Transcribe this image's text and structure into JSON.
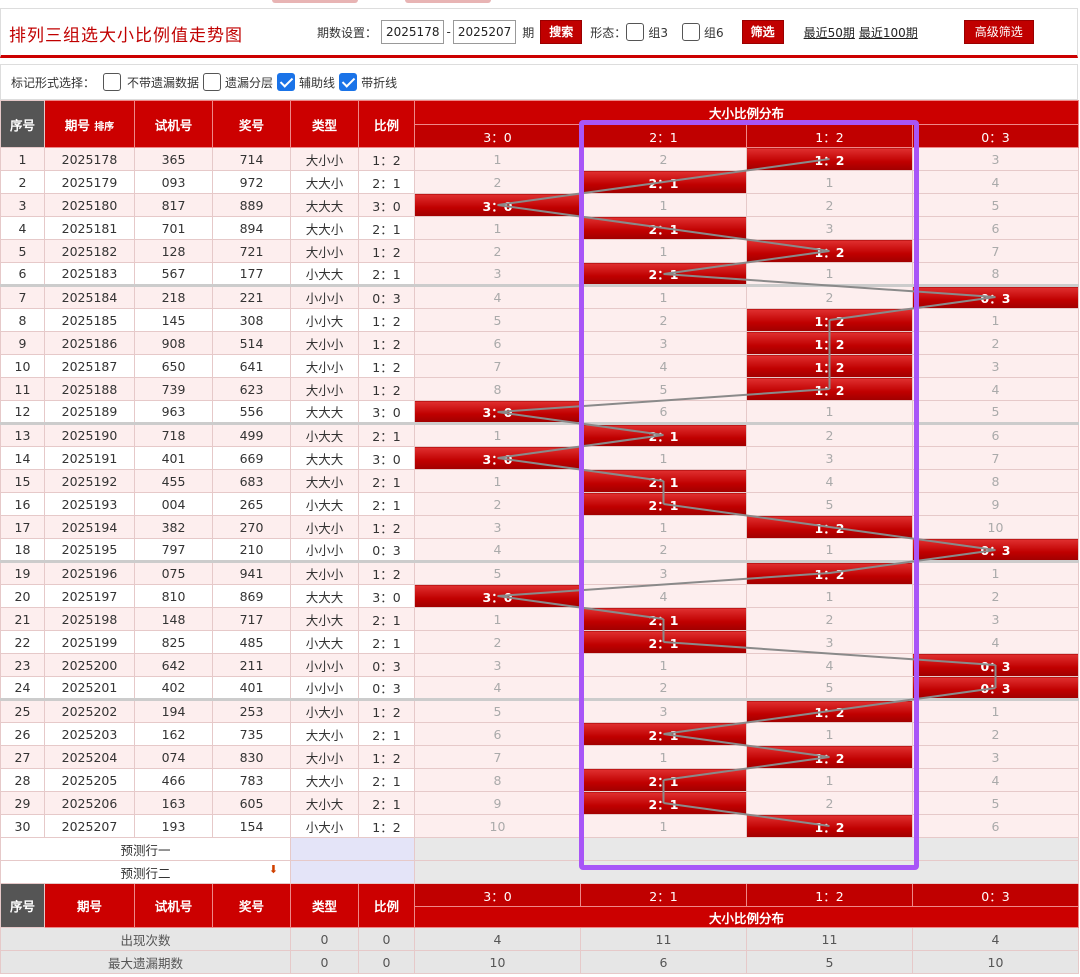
{
  "header": {
    "title": "排列三组选大小比例值走势图",
    "period_label": "期数设置：",
    "period_start": "2025178",
    "period_sep": "-",
    "period_end": "2025207",
    "period_unit": "期",
    "search_btn": "搜索",
    "shape_label": "形态：",
    "group3_label": "组3",
    "group6_label": "组6",
    "filter_btn": "筛选",
    "recent50": "最近50期",
    "recent100": "最近100期",
    "advanced_btn": "高级筛选"
  },
  "mark_bar": {
    "label": "标记形式选择：",
    "opt1": "不带遗漏数据",
    "opt2": "遗漏分层",
    "opt3": "辅助线",
    "opt4": "带折线"
  },
  "table_head": {
    "seq": "序号",
    "issue": "期号",
    "sort": "排序",
    "test": "试机号",
    "prize": "奖号",
    "type": "类型",
    "ratio": "比例",
    "dist": "大小比例分布",
    "cols": [
      "3：0",
      "2：1",
      "1：2",
      "0：3"
    ]
  },
  "rows": [
    {
      "seq": "1",
      "issue": "2025178",
      "test": "365",
      "prize": "714",
      "type": "大小小",
      "ratio": "1：2",
      "d": [
        "1",
        "2",
        "1：2",
        "3"
      ],
      "hit": 2
    },
    {
      "seq": "2",
      "issue": "2025179",
      "test": "093",
      "prize": "972",
      "type": "大大小",
      "ratio": "2：1",
      "d": [
        "2",
        "2：1",
        "1",
        "4"
      ],
      "hit": 1
    },
    {
      "seq": "3",
      "issue": "2025180",
      "test": "817",
      "prize": "889",
      "type": "大大大",
      "ratio": "3：0",
      "d": [
        "3：0",
        "1",
        "2",
        "5"
      ],
      "hit": 0
    },
    {
      "seq": "4",
      "issue": "2025181",
      "test": "701",
      "prize": "894",
      "type": "大大小",
      "ratio": "2：1",
      "d": [
        "1",
        "2：1",
        "3",
        "6"
      ],
      "hit": 1
    },
    {
      "seq": "5",
      "issue": "2025182",
      "test": "128",
      "prize": "721",
      "type": "大小小",
      "ratio": "1：2",
      "d": [
        "2",
        "1",
        "1：2",
        "7"
      ],
      "hit": 2
    },
    {
      "seq": "6",
      "issue": "2025183",
      "test": "567",
      "prize": "177",
      "type": "小大大",
      "ratio": "2：1",
      "d": [
        "3",
        "2：1",
        "1",
        "8"
      ],
      "hit": 1
    },
    {
      "seq": "7",
      "issue": "2025184",
      "test": "218",
      "prize": "221",
      "type": "小小小",
      "ratio": "0：3",
      "d": [
        "4",
        "1",
        "2",
        "0：3"
      ],
      "hit": 3
    },
    {
      "seq": "8",
      "issue": "2025185",
      "test": "145",
      "prize": "308",
      "type": "小小大",
      "ratio": "1：2",
      "d": [
        "5",
        "2",
        "1：2",
        "1"
      ],
      "hit": 2
    },
    {
      "seq": "9",
      "issue": "2025186",
      "test": "908",
      "prize": "514",
      "type": "大小小",
      "ratio": "1：2",
      "d": [
        "6",
        "3",
        "1：2",
        "2"
      ],
      "hit": 2
    },
    {
      "seq": "10",
      "issue": "2025187",
      "test": "650",
      "prize": "641",
      "type": "大小小",
      "ratio": "1：2",
      "d": [
        "7",
        "4",
        "1：2",
        "3"
      ],
      "hit": 2
    },
    {
      "seq": "11",
      "issue": "2025188",
      "test": "739",
      "prize": "623",
      "type": "大小小",
      "ratio": "1：2",
      "d": [
        "8",
        "5",
        "1：2",
        "4"
      ],
      "hit": 2
    },
    {
      "seq": "12",
      "issue": "2025189",
      "test": "963",
      "prize": "556",
      "type": "大大大",
      "ratio": "3：0",
      "d": [
        "3：0",
        "6",
        "1",
        "5"
      ],
      "hit": 0
    },
    {
      "seq": "13",
      "issue": "2025190",
      "test": "718",
      "prize": "499",
      "type": "小大大",
      "ratio": "2：1",
      "d": [
        "1",
        "2：1",
        "2",
        "6"
      ],
      "hit": 1
    },
    {
      "seq": "14",
      "issue": "2025191",
      "test": "401",
      "prize": "669",
      "type": "大大大",
      "ratio": "3：0",
      "d": [
        "3：0",
        "1",
        "3",
        "7"
      ],
      "hit": 0
    },
    {
      "seq": "15",
      "issue": "2025192",
      "test": "455",
      "prize": "683",
      "type": "大大小",
      "ratio": "2：1",
      "d": [
        "1",
        "2：1",
        "4",
        "8"
      ],
      "hit": 1
    },
    {
      "seq": "16",
      "issue": "2025193",
      "test": "004",
      "prize": "265",
      "type": "小大大",
      "ratio": "2：1",
      "d": [
        "2",
        "2：1",
        "5",
        "9"
      ],
      "hit": 1
    },
    {
      "seq": "17",
      "issue": "2025194",
      "test": "382",
      "prize": "270",
      "type": "小大小",
      "ratio": "1：2",
      "d": [
        "3",
        "1",
        "1：2",
        "10"
      ],
      "hit": 2
    },
    {
      "seq": "18",
      "issue": "2025195",
      "test": "797",
      "prize": "210",
      "type": "小小小",
      "ratio": "0：3",
      "d": [
        "4",
        "2",
        "1",
        "0：3"
      ],
      "hit": 3
    },
    {
      "seq": "19",
      "issue": "2025196",
      "test": "075",
      "prize": "941",
      "type": "大小小",
      "ratio": "1：2",
      "d": [
        "5",
        "3",
        "1：2",
        "1"
      ],
      "hit": 2
    },
    {
      "seq": "20",
      "issue": "2025197",
      "test": "810",
      "prize": "869",
      "type": "大大大",
      "ratio": "3：0",
      "d": [
        "3：0",
        "4",
        "1",
        "2"
      ],
      "hit": 0
    },
    {
      "seq": "21",
      "issue": "2025198",
      "test": "148",
      "prize": "717",
      "type": "大小大",
      "ratio": "2：1",
      "d": [
        "1",
        "2：1",
        "2",
        "3"
      ],
      "hit": 1
    },
    {
      "seq": "22",
      "issue": "2025199",
      "test": "825",
      "prize": "485",
      "type": "小大大",
      "ratio": "2：1",
      "d": [
        "2",
        "2：1",
        "3",
        "4"
      ],
      "hit": 1
    },
    {
      "seq": "23",
      "issue": "2025200",
      "test": "642",
      "prize": "211",
      "type": "小小小",
      "ratio": "0：3",
      "d": [
        "3",
        "1",
        "4",
        "0：3"
      ],
      "hit": 3
    },
    {
      "seq": "24",
      "issue": "2025201",
      "test": "402",
      "prize": "401",
      "type": "小小小",
      "ratio": "0：3",
      "d": [
        "4",
        "2",
        "5",
        "0：3"
      ],
      "hit": 3
    },
    {
      "seq": "25",
      "issue": "2025202",
      "test": "194",
      "prize": "253",
      "type": "小大小",
      "ratio": "1：2",
      "d": [
        "5",
        "3",
        "1：2",
        "1"
      ],
      "hit": 2
    },
    {
      "seq": "26",
      "issue": "2025203",
      "test": "162",
      "prize": "735",
      "type": "大大小",
      "ratio": "2：1",
      "d": [
        "6",
        "2：1",
        "1",
        "2"
      ],
      "hit": 1
    },
    {
      "seq": "27",
      "issue": "2025204",
      "test": "074",
      "prize": "830",
      "type": "大小小",
      "ratio": "1：2",
      "d": [
        "7",
        "1",
        "1：2",
        "3"
      ],
      "hit": 2
    },
    {
      "seq": "28",
      "issue": "2025205",
      "test": "466",
      "prize": "783",
      "type": "大大小",
      "ratio": "2：1",
      "d": [
        "8",
        "2：1",
        "1",
        "4"
      ],
      "hit": 1
    },
    {
      "seq": "29",
      "issue": "2025206",
      "test": "163",
      "prize": "605",
      "type": "大小大",
      "ratio": "2：1",
      "d": [
        "9",
        "2：1",
        "2",
        "5"
      ],
      "hit": 1
    },
    {
      "seq": "30",
      "issue": "2025207",
      "test": "193",
      "prize": "154",
      "type": "小大小",
      "ratio": "1：2",
      "d": [
        "10",
        "1",
        "1：2",
        "6"
      ],
      "hit": 2
    }
  ],
  "predict": {
    "row1": "预测行一",
    "row2": "预测行二"
  },
  "stats": [
    {
      "label": "出现次数",
      "type": "0",
      "ratio": "0",
      "vals": [
        "4",
        "11",
        "11",
        "4"
      ]
    },
    {
      "label": "最大遗漏期数",
      "type": "0",
      "ratio": "0",
      "vals": [
        "10",
        "6",
        "5",
        "10"
      ]
    }
  ],
  "colors": {
    "accent": "#c00000",
    "highlight": "#a855f7",
    "missing_bg": "#fdeeee",
    "trend_line": "#8a8a8a"
  }
}
